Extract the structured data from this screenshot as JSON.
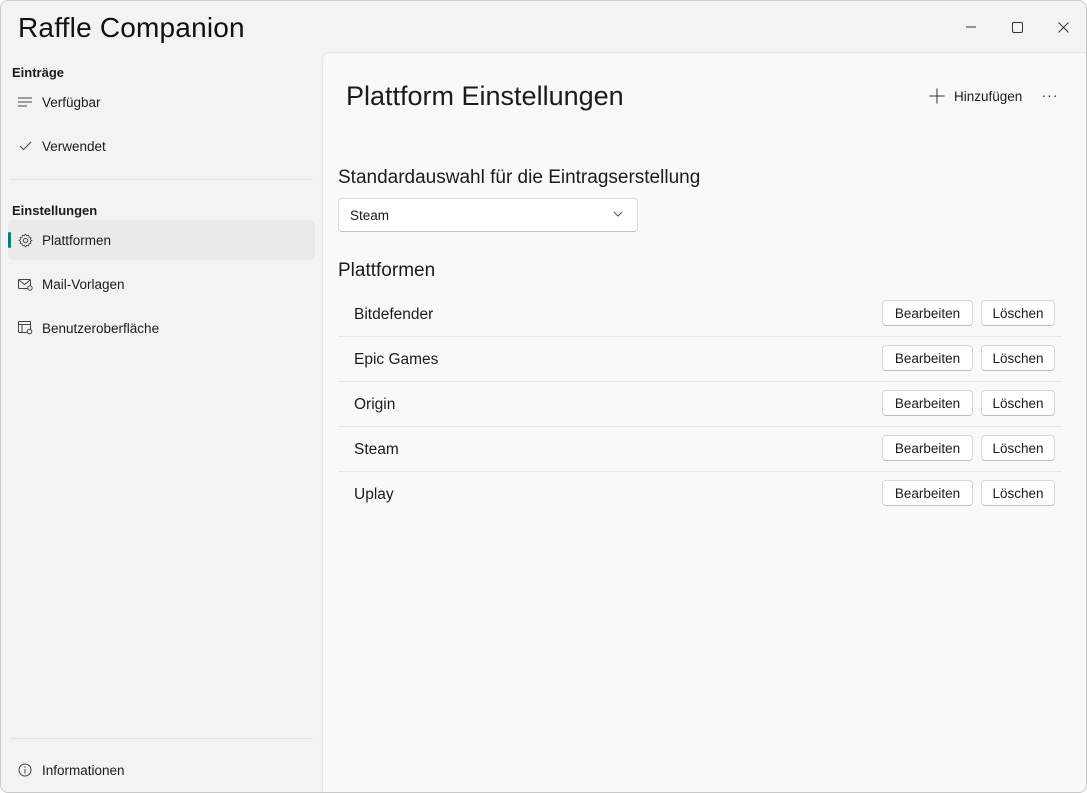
{
  "window": {
    "title": "Raffle Companion"
  },
  "sidebar": {
    "section_entries": "Einträge",
    "entries": [
      {
        "label": "Verfügbar",
        "icon": "lines-icon"
      },
      {
        "label": "Verwendet",
        "icon": "checkmark-icon"
      }
    ],
    "section_settings": "Einstellungen",
    "settings": [
      {
        "label": "Plattformen",
        "icon": "gear-icon",
        "selected": true
      },
      {
        "label": "Mail-Vorlagen",
        "icon": "mail-settings-icon"
      },
      {
        "label": "Benutzeroberfläche",
        "icon": "ui-settings-icon"
      }
    ],
    "footer": {
      "label": "Informationen",
      "icon": "info-icon"
    },
    "accent_color": "#0f7b6c"
  },
  "main": {
    "title": "Plattform Einstellungen",
    "add_label": "Hinzufügen",
    "more_label": "···",
    "default_section": "Standardauswahl für die Eintragserstellung",
    "default_value": "Steam",
    "platforms_section": "Plattformen",
    "edit_label": "Bearbeiten",
    "delete_label": "Löschen",
    "platforms": [
      "Bitdefender",
      "Epic Games",
      "Origin",
      "Steam",
      "Uplay"
    ]
  }
}
